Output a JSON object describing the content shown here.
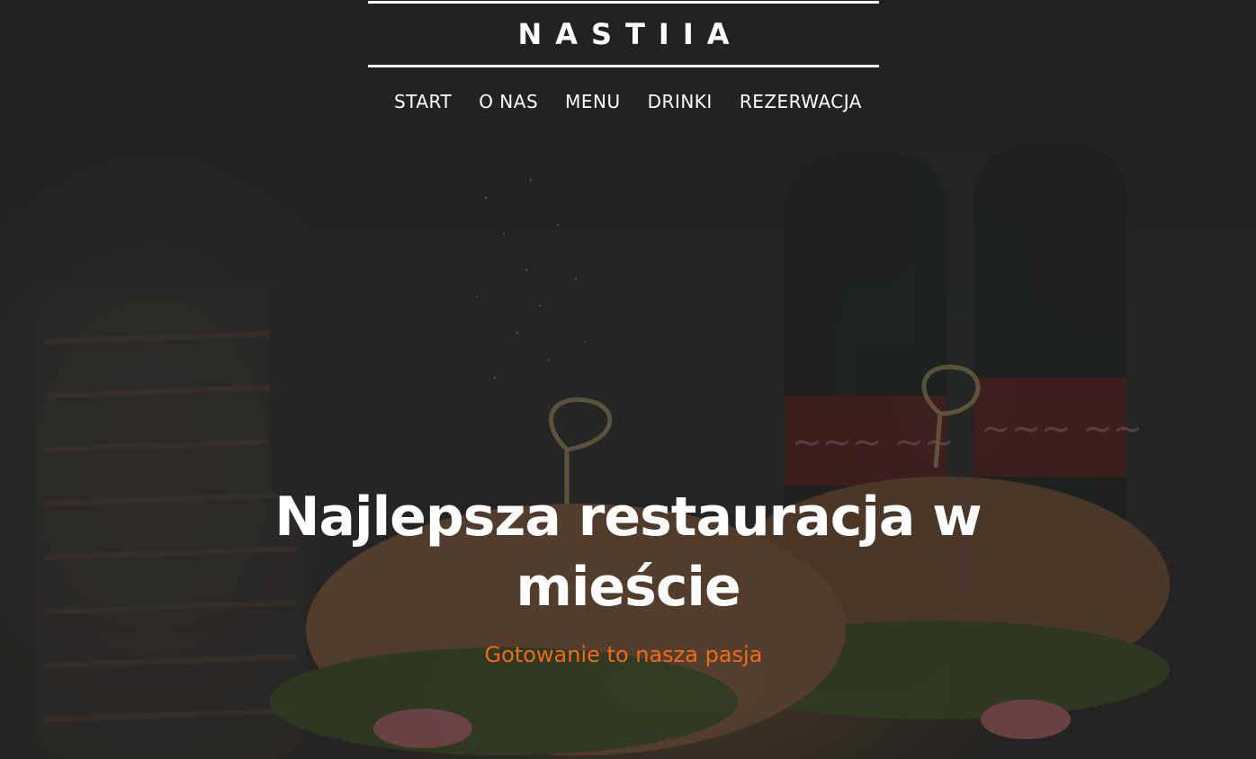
{
  "brand": {
    "logo_text": "NASTIIA"
  },
  "nav": {
    "items": [
      {
        "label": "START"
      },
      {
        "label": "O NAS"
      },
      {
        "label": "MENU"
      },
      {
        "label": "DRINKI"
      },
      {
        "label": "REZERWACJA"
      }
    ]
  },
  "hero": {
    "headline_line1": "Najlepsza restauracja w",
    "headline_line2": "mieście",
    "tagline": "Gotowanie to nasza pasja"
  },
  "colors": {
    "accent": "#f06a1a",
    "text": "#ffffff",
    "background": "#262626"
  }
}
